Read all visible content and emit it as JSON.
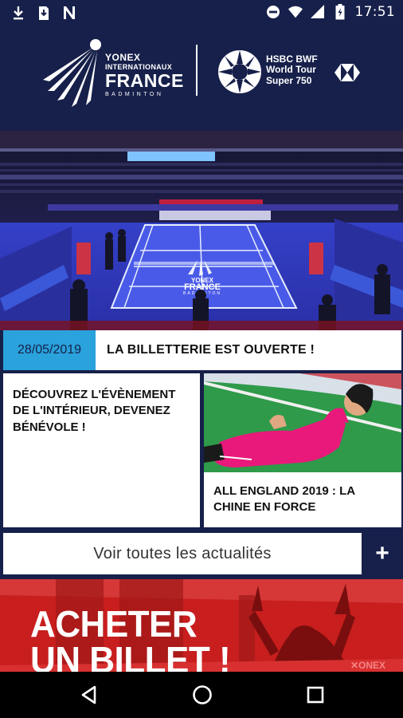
{
  "status_bar": {
    "time": "17:51",
    "left_icons": [
      "download-icon",
      "sd-card-download-icon",
      "n-app-icon"
    ],
    "right_icons": [
      "do-not-disturb-icon",
      "wifi-icon",
      "signal-icon",
      "battery-icon"
    ]
  },
  "header": {
    "left_logo": {
      "line1": "YONEX",
      "line2": "INTERNATIONAUX",
      "line3": "FRANCE",
      "line4": "BADMINTON"
    },
    "right_logo": {
      "line1": "HSBC BWF",
      "line2": "World Tour",
      "line3": "Super 750"
    }
  },
  "hero": {
    "date": "28/05/2019",
    "title": "LA BILLETTERIE EST OUVERTE !",
    "court_logo_line1": "YONEX",
    "court_logo_line2": "FRANCE",
    "court_logo_line3": "BADMINTON"
  },
  "cards": [
    {
      "title": "DÉCOUVREZ L'ÉVÈNEMENT DE L'INTÉRIEUR, DEVENEZ BÉNÉVOLE !"
    },
    {
      "title": "ALL ENGLAND 2019 : LA CHINE EN FORCE"
    }
  ],
  "see_all": {
    "label": "Voir toutes les actualités",
    "plus": "+"
  },
  "ticket_banner": {
    "line1": "ACHETER",
    "line2": "UN BILLET !"
  },
  "colors": {
    "navy": "#16204a",
    "accent_blue": "#2aa2dc",
    "court_blue": "#3b44d6",
    "ticket_red": "#c81e1e",
    "player_pink": "#e8197b"
  }
}
